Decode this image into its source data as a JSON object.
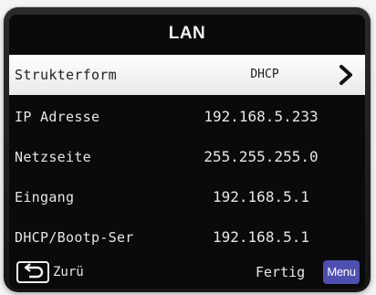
{
  "screen": {
    "title": "LAN"
  },
  "rows": [
    {
      "label": "Strukterform",
      "value": "DHCP",
      "selected": true
    },
    {
      "label": "IP Adresse",
      "value": "192.168.5.233"
    },
    {
      "label": "Netzseite",
      "value": "255.255.255.0"
    },
    {
      "label": "Eingang",
      "value": "192.168.5.1"
    },
    {
      "label": "DHCP/Bootp-Ser",
      "value": "192.168.5.1"
    }
  ],
  "footer": {
    "back_label": "Zurü",
    "done_label": "Fertig",
    "menu_label": "Menu"
  },
  "icons": {
    "chevron": "chevron-right-icon",
    "back": "back-arrow-icon"
  },
  "colors": {
    "menu_button": "#4f4fb0",
    "selected_row": "#ffffff",
    "screen_background": "#0a0a0a"
  }
}
